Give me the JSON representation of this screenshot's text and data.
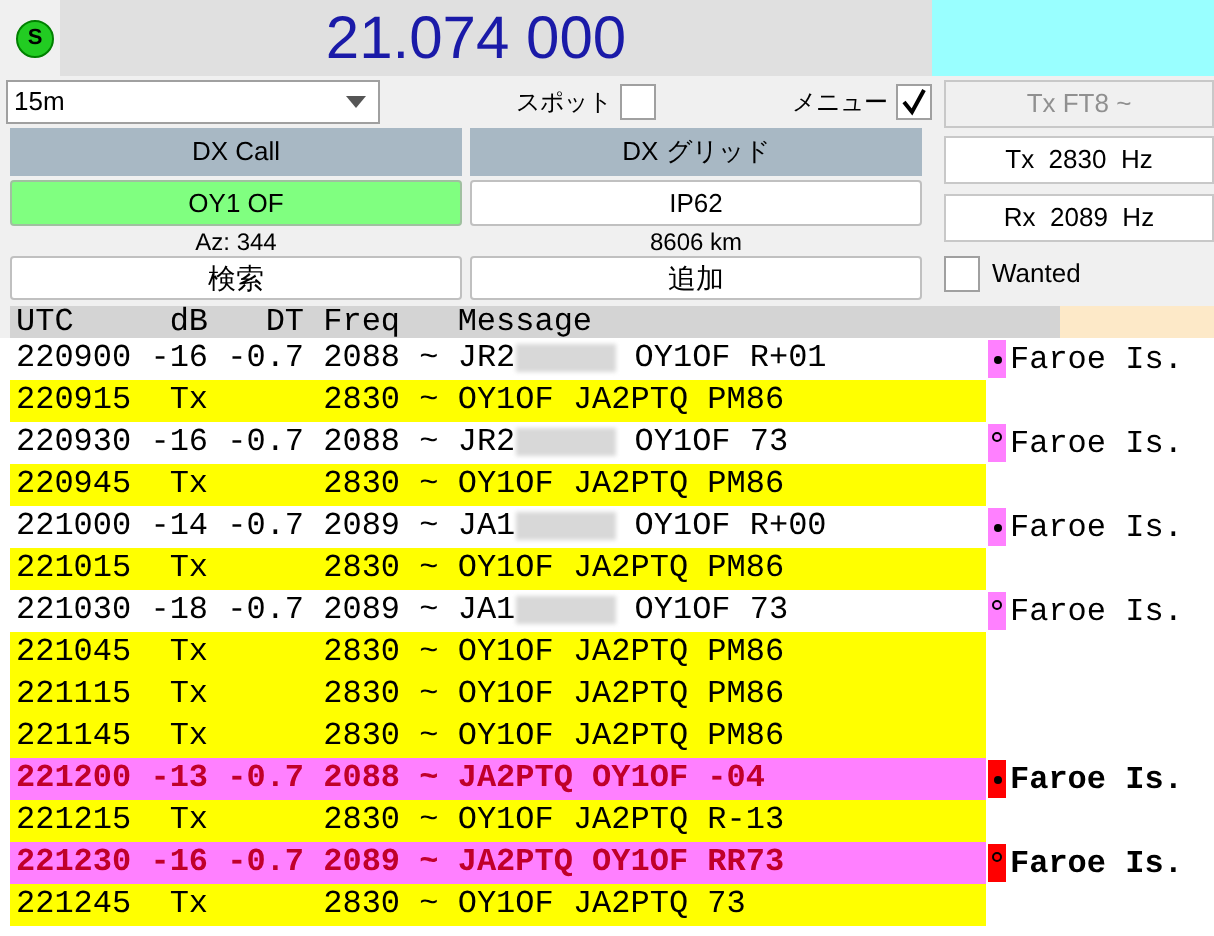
{
  "status_badge": "S",
  "frequency": "21.074 000",
  "band_select": {
    "value": "15m"
  },
  "spot": {
    "label": "スポット",
    "checked": false
  },
  "menu": {
    "label": "メニュー",
    "checked": true
  },
  "tx_mode_button": {
    "label": "Tx FT8 ~",
    "disabled": true
  },
  "tx_freq": "Tx  2830  Hz",
  "rx_freq": "Rx  2089  Hz",
  "wanted": {
    "label": "Wanted",
    "checked": false
  },
  "dx_call": {
    "header": "DX Call",
    "value": "OY1 OF",
    "info": "Az: 344",
    "button": "検索"
  },
  "dx_grid": {
    "header": "DX グリッド",
    "value": "IP62",
    "info": "8606 km",
    "button": "追加"
  },
  "table": {
    "separator": "~",
    "columns": [
      "UTC",
      "dB",
      "DT",
      "Freq",
      "Message"
    ],
    "rows": [
      {
        "kind": "rx",
        "utc": "220900",
        "db": "-16",
        "dt": "-0.7",
        "freq": "2088",
        "message": [
          "JR2",
          "OY1OF R+01"
        ],
        "redacted": true,
        "marker": {
          "kind": "dot",
          "color": "#ff80ff"
        },
        "country": "Faroe Is."
      },
      {
        "kind": "tx",
        "utc": "220915",
        "db": "Tx",
        "freq": "2830",
        "message": [
          "OY1OF JA2PTQ PM86"
        ],
        "redacted": false
      },
      {
        "kind": "rx",
        "utc": "220930",
        "db": "-16",
        "dt": "-0.7",
        "freq": "2088",
        "message": [
          "JR2",
          "OY1OF 73"
        ],
        "redacted": true,
        "marker": {
          "kind": "circle",
          "color": "#ff80ff"
        },
        "country": "Faroe Is."
      },
      {
        "kind": "tx",
        "utc": "220945",
        "db": "Tx",
        "freq": "2830",
        "message": [
          "OY1OF JA2PTQ PM86"
        ],
        "redacted": false
      },
      {
        "kind": "rx",
        "utc": "221000",
        "db": "-14",
        "dt": "-0.7",
        "freq": "2089",
        "message": [
          "JA1",
          "OY1OF R+00"
        ],
        "redacted": true,
        "marker": {
          "kind": "dot",
          "color": "#ff80ff"
        },
        "country": "Faroe Is."
      },
      {
        "kind": "tx",
        "utc": "221015",
        "db": "Tx",
        "freq": "2830",
        "message": [
          "OY1OF JA2PTQ PM86"
        ],
        "redacted": false
      },
      {
        "kind": "rx",
        "utc": "221030",
        "db": "-18",
        "dt": "-0.7",
        "freq": "2089",
        "message": [
          "JA1",
          "OY1OF 73"
        ],
        "redacted": true,
        "marker": {
          "kind": "circle",
          "color": "#ff80ff"
        },
        "country": "Faroe Is."
      },
      {
        "kind": "tx",
        "utc": "221045",
        "db": "Tx",
        "freq": "2830",
        "message": [
          "OY1OF JA2PTQ PM86"
        ],
        "redacted": false
      },
      {
        "kind": "tx",
        "utc": "221115",
        "db": "Tx",
        "freq": "2830",
        "message": [
          "OY1OF JA2PTQ PM86"
        ],
        "redacted": false
      },
      {
        "kind": "tx",
        "utc": "221145",
        "db": "Tx",
        "freq": "2830",
        "message": [
          "OY1OF JA2PTQ PM86"
        ],
        "redacted": false
      },
      {
        "kind": "to_me",
        "utc": "221200",
        "db": "-13",
        "dt": "-0.7",
        "freq": "2088",
        "message": [
          "JA2PTQ OY1OF -04"
        ],
        "redacted": false,
        "marker": {
          "kind": "dot",
          "color": "#ff0000"
        },
        "country": "Faroe Is."
      },
      {
        "kind": "tx",
        "utc": "221215",
        "db": "Tx",
        "freq": "2830",
        "message": [
          "OY1OF JA2PTQ R-13"
        ],
        "redacted": false
      },
      {
        "kind": "to_me",
        "utc": "221230",
        "db": "-16",
        "dt": "-0.7",
        "freq": "2089",
        "message": [
          "JA2PTQ OY1OF RR73"
        ],
        "redacted": false,
        "marker": {
          "kind": "circle",
          "color": "#ff0000"
        },
        "country": "Faroe Is."
      },
      {
        "kind": "tx",
        "utc": "221245",
        "db": "Tx",
        "freq": "2830",
        "message": [
          "OY1OF JA2PTQ 73"
        ],
        "redacted": false
      }
    ]
  }
}
